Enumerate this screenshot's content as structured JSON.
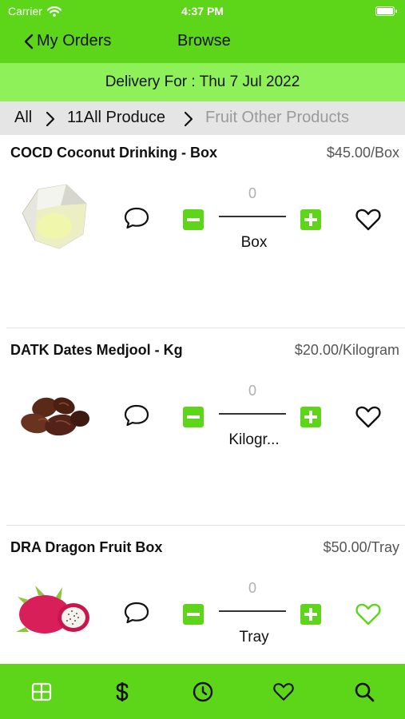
{
  "status_bar": {
    "carrier": "Carrier",
    "time": "4:37 PM"
  },
  "nav": {
    "back_label": "My Orders",
    "title": "Browse"
  },
  "delivery": {
    "text": "Delivery For : Thu 7 Jul 2022"
  },
  "breadcrumb": {
    "items": [
      "All",
      "11All Produce",
      "Fruit Other Products"
    ]
  },
  "products": [
    {
      "name": "COCD Coconut Drinking - Box",
      "price": "$45.00/Box",
      "quantity": "0",
      "unit": "Box",
      "favorite": false,
      "image": "coconut-image"
    },
    {
      "name": "DATK Dates Medjool - Kg",
      "price": "$20.00/Kilogram",
      "quantity": "0",
      "unit": "Kilogr...",
      "favorite": false,
      "image": "dates-image"
    },
    {
      "name": "DRA Dragon Fruit Box",
      "price": "$50.00/Tray",
      "quantity": "0",
      "unit": "Tray",
      "favorite": true,
      "image": "dragon-fruit-image"
    }
  ],
  "tabbar": {
    "tabs": [
      "grid-icon",
      "dollar-icon",
      "clock-icon",
      "heart-icon",
      "search-icon"
    ]
  },
  "colors": {
    "brand_green": "#5dd61a",
    "light_green": "#8ef15a",
    "crumb_bg": "#e5e5e5"
  }
}
